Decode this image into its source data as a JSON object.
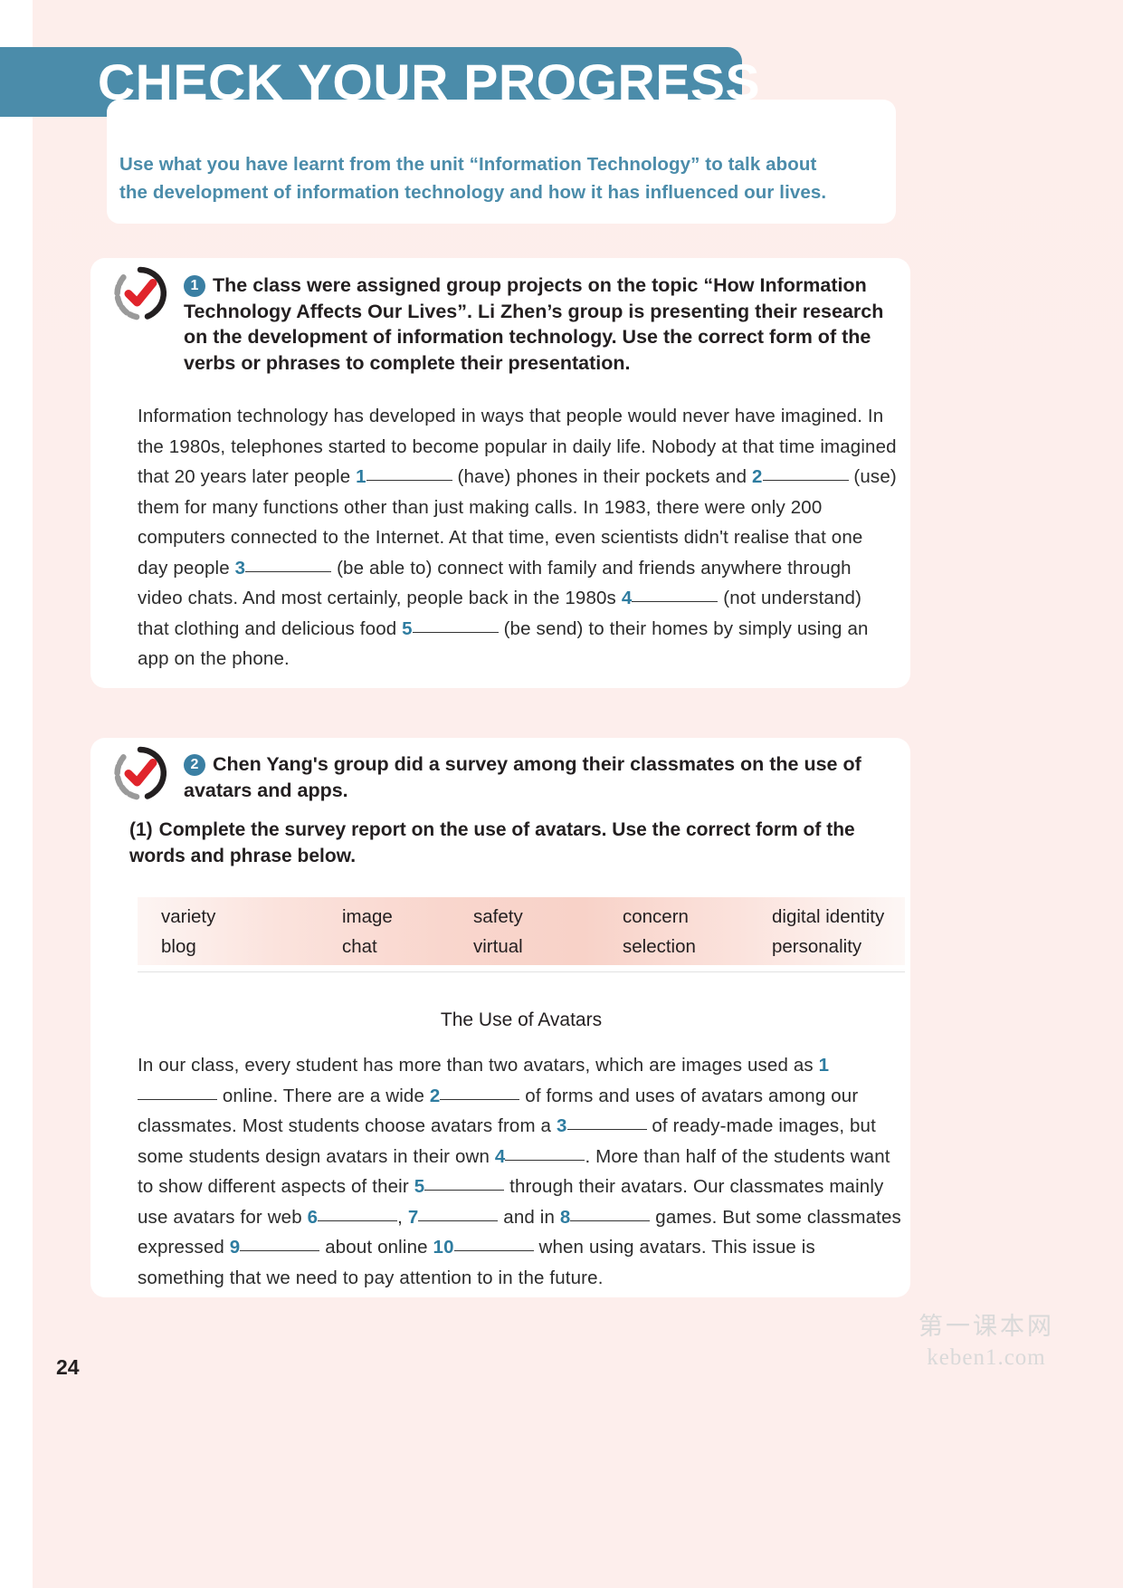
{
  "banner": {
    "title": "CHECK YOUR PROGRESS"
  },
  "intro": {
    "text": "Use what you have learnt from the unit “Information Technology” to talk about the development of information technology and how it has influenced our lives."
  },
  "colors": {
    "accent_teal": "#4b8caa",
    "badge_blue": "#3a7fa3",
    "blank_blue": "#2e7ca0",
    "check_red": "#e0242b",
    "page_bg": "#fdeeec",
    "wordbank_pink": "#f8d2c8"
  },
  "task1": {
    "number": "1",
    "heading": "The class were assigned group projects on the topic “How Information Technology Affects Our Lives”. Li Zhen’s group is presenting their research on the development of information technology. Use the correct form of the verbs or phrases to complete their presentation.",
    "paragraph": {
      "s1": "Information technology has developed in ways that people would never have imagined. In the 1980s, telephones started to become popular in daily life. Nobody at that time imagined that 20 years later people ",
      "n1": "1",
      "s2": " (have) phones in their pockets and ",
      "n2": "2",
      "s3": " (use) them for many functions other than just making calls. In 1983, there were only 200 computers connected to the Internet. At that time, even scientists didn't realise that one day people ",
      "n3": "3",
      "s4": " (be able to) connect with family and friends anywhere through video chats. And most certainly, people back in the 1980s ",
      "n4": "4",
      "s5": " (not understand) that clothing and delicious food ",
      "n5": "5",
      "s6": " (be send) to their homes by simply using an app on the phone."
    }
  },
  "task2": {
    "number": "2",
    "heading": "Chen Yang's group did a survey among their classmates on the use of avatars and apps.",
    "subitem": {
      "label": "(1)",
      "text": "Complete the survey report on the use of avatars. Use the correct form of the words and phrase below."
    },
    "word_bank": [
      "variety",
      "image",
      "safety",
      "concern",
      "digital identity",
      "blog",
      "chat",
      "virtual",
      "selection",
      "personality"
    ],
    "report_title": "The Use of Avatars",
    "report": {
      "s1": "In our class, every student has more than two avatars, which are images used as ",
      "n1": "1",
      "s2": " online. There are a wide ",
      "n2": "2",
      "s3": " of forms and uses of avatars among our classmates. Most students choose avatars from a ",
      "n3": "3",
      "s4": " of ready-made images, but some students design avatars in their own ",
      "n4": "4",
      "s5": ". More than half of the students want to show different aspects of their ",
      "n5": "5",
      "s6": " through their avatars. Our classmates mainly use avatars for web ",
      "n6": "6",
      "s7": ", ",
      "n7": "7",
      "s8": " and in ",
      "n8": "8",
      "s9": " games. But some classmates expressed ",
      "n9": "9",
      "s10": " about online ",
      "n10": "10",
      "s11": " when using avatars. This issue is something that we need to pay attention to in the future."
    }
  },
  "footer": {
    "page_number": "24",
    "watermark_cn": "第一课本网",
    "watermark_en": "keben1.com"
  },
  "icons": {
    "check": "check-mark-icon",
    "ring": "progress-ring-icon"
  }
}
